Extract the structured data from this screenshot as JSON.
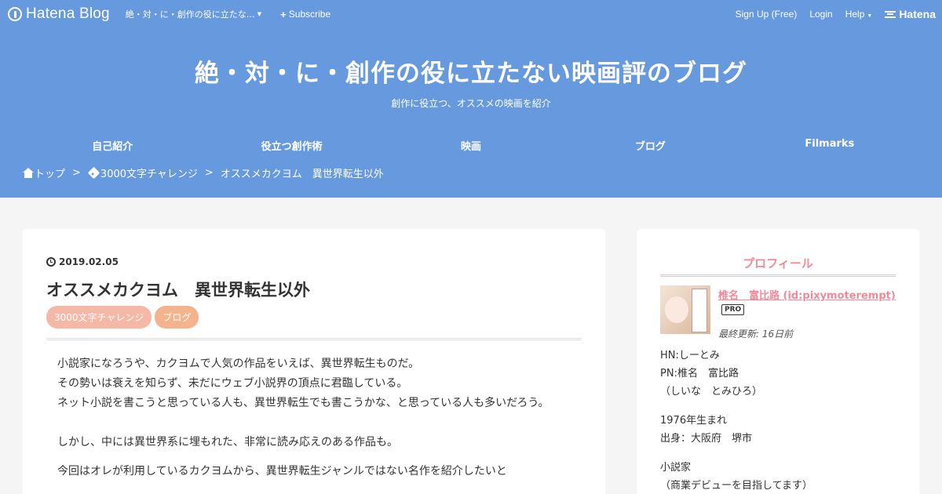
{
  "topbar": {
    "brand": "Hatena Blog",
    "blog_menu": "絶・対・に・創作の役に立たな…",
    "subscribe": "Subscribe",
    "signup": "Sign Up (Free)",
    "login": "Login",
    "help": "Help",
    "hatena": "Hatena"
  },
  "header": {
    "title": "絶・対・に・創作の役に立たない映画評のブログ",
    "description": "創作に役立つ、オススメの映画を紹介",
    "nav": [
      "自己紹介",
      "役立つ創作術",
      "映画",
      "ブログ",
      "Filmarks"
    ],
    "breadcrumb": {
      "home": "トップ",
      "separator": ">",
      "category": "3000文字チャレンジ",
      "current": "オススメカクヨム　異世界転生以外"
    }
  },
  "entry": {
    "date": "2019.02.05",
    "title": "オススメカクヨム　異世界転生以外",
    "categories": [
      "3000文字チャレンジ",
      "ブログ"
    ],
    "paragraphs": [
      "小説家になろうや、カクヨムで人気の作品をいえば、異世界転生ものだ。",
      "その勢いは衰えを知らず、未だにウェブ小説界の頂点に君臨している。",
      "ネット小説を書こうと思っている人も、異世界転生でも書こうかな、と思っている人も多いだろう。",
      "しかし、中には異世界系に埋もれた、非常に読み応えのある作品も。",
      "今回はオレが利用しているカクヨムから、異世界転生ジャンルではない名作を紹介したいと"
    ]
  },
  "sidebar": {
    "title": "プロフィール",
    "name": "椎名　富比路 (id:pixymoterempt)",
    "badge": "PRO",
    "updated": "最終更新: 16日前",
    "lines": [
      "HN:しーとみ",
      "PN:椎名　富比路",
      "（しいな　とみひろ）",
      "1976年生まれ",
      "出身：大阪府　堺市",
      "小説家",
      "（商業デビューを目指してます）"
    ]
  },
  "colors": {
    "header_bg": "#6699dd",
    "accent_pink": "#f08a9a",
    "tag_bg": "#f5b8a6"
  }
}
